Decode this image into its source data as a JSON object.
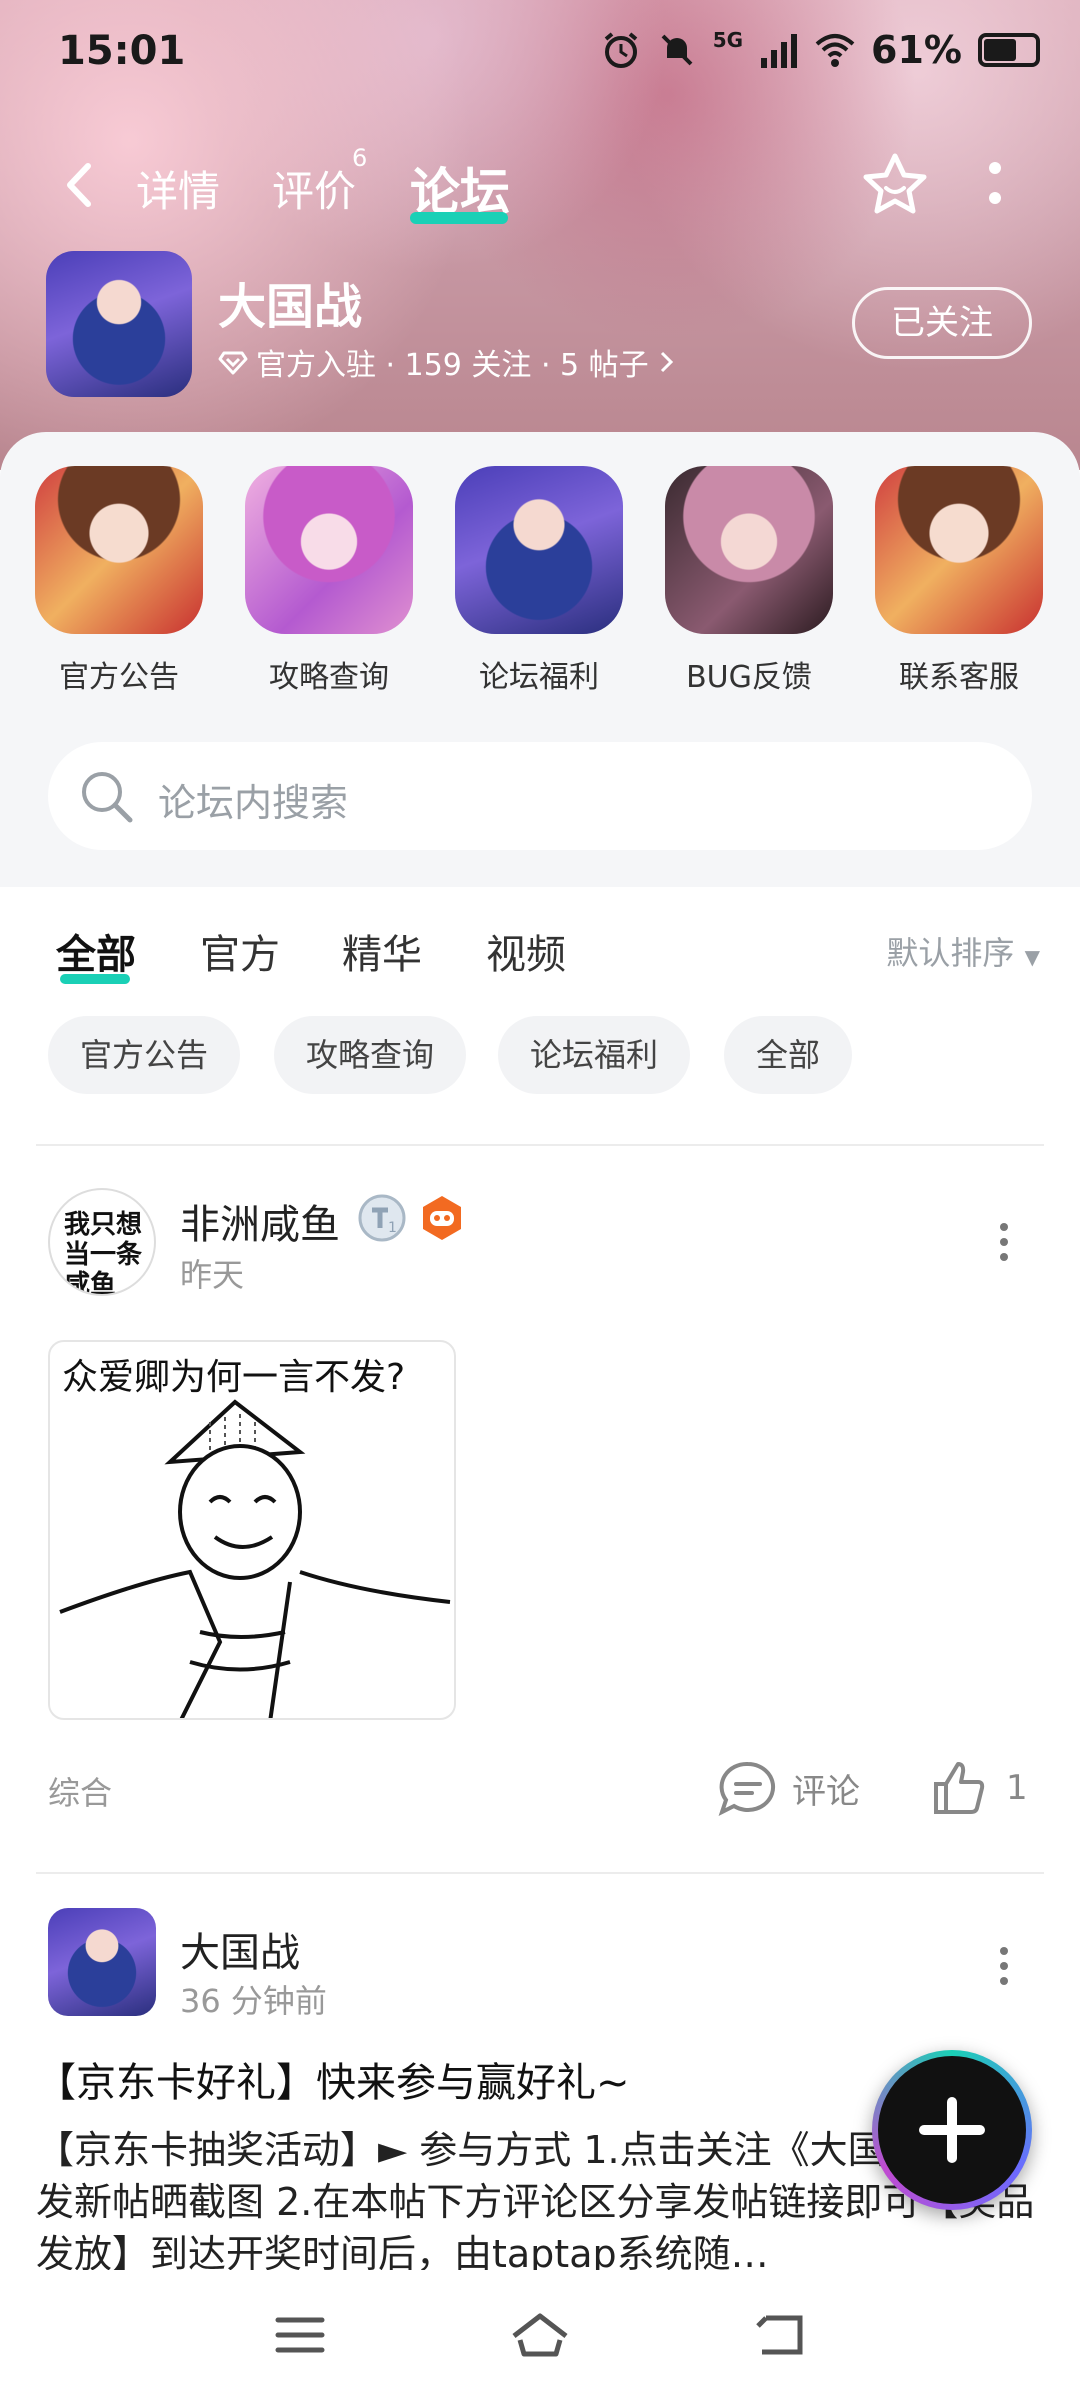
{
  "status_bar": {
    "time": "15:01",
    "network": "5G",
    "battery": "61%"
  },
  "nav": {
    "tabs": [
      {
        "label": "详情"
      },
      {
        "label": "评价",
        "count": "6"
      },
      {
        "label": "论坛",
        "active": true
      }
    ]
  },
  "game": {
    "title": "大国战",
    "meta": "官方入驻 · 159 关注 · 5 帖子",
    "follow_label": "已关注"
  },
  "entries": [
    {
      "label": "官方公告"
    },
    {
      "label": "攻略查询"
    },
    {
      "label": "论坛福利"
    },
    {
      "label": "BUG反馈"
    },
    {
      "label": "联系客服"
    }
  ],
  "search": {
    "placeholder": "论坛内搜索"
  },
  "filter_tabs": [
    {
      "label": "全部",
      "active": true
    },
    {
      "label": "官方"
    },
    {
      "label": "精华"
    },
    {
      "label": "视频"
    }
  ],
  "sort_label": "默认排序",
  "chips": [
    "官方公告",
    "攻略查询",
    "论坛福利",
    "全部"
  ],
  "posts": [
    {
      "author": "非洲咸鱼",
      "avatar_text": "我只想当一条咸鱼",
      "time": "昨天",
      "image_caption": "众爱卿为何一言不发?",
      "tag": "综合",
      "comment_label": "评论",
      "likes": "1"
    },
    {
      "author": "大国战",
      "time": "36 分钟前",
      "title": "【京东卡好礼】快来参与赢好礼~",
      "body": "【京东卡抽奖活动】► 参与方式 1.点击关注《大国战》并发新帖晒截图 2.在本帖下方评论区分享发帖链接即可【奖品发放】到达开奖时间后，由taptap系统随…"
    }
  ],
  "colors": {
    "accent": "#1ad0b6",
    "muted_text": "#999999"
  }
}
